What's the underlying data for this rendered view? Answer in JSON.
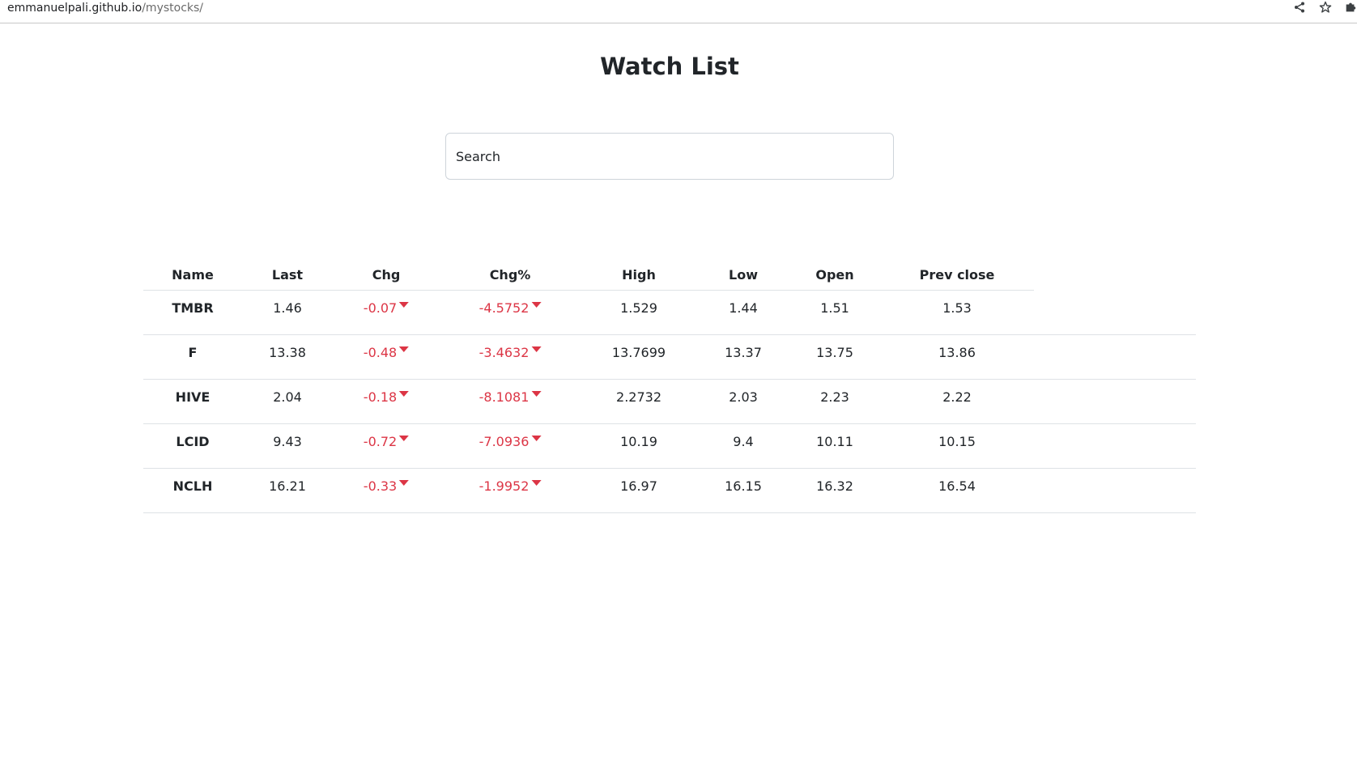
{
  "browser": {
    "url_host": "emmanuelpali.github.io",
    "url_path": "/mystocks/",
    "icons": [
      "share-icon",
      "star-icon",
      "extensions-icon"
    ]
  },
  "page": {
    "title": "Watch List",
    "search_placeholder": "Search"
  },
  "table": {
    "columns": [
      "Name",
      "Last",
      "Chg",
      "Chg%",
      "High",
      "Low",
      "Open",
      "Prev close"
    ],
    "rows": [
      {
        "name": "TMBR",
        "last": "1.46",
        "chg": "-0.07",
        "chg_pct": "-4.5752",
        "high": "1.529",
        "low": "1.44",
        "open": "1.51",
        "prev_close": "1.53"
      },
      {
        "name": "F",
        "last": "13.38",
        "chg": "-0.48",
        "chg_pct": "-3.4632",
        "high": "13.7699",
        "low": "13.37",
        "open": "13.75",
        "prev_close": "13.86"
      },
      {
        "name": "HIVE",
        "last": "2.04",
        "chg": "-0.18",
        "chg_pct": "-8.1081",
        "high": "2.2732",
        "low": "2.03",
        "open": "2.23",
        "prev_close": "2.22"
      },
      {
        "name": "LCID",
        "last": "9.43",
        "chg": "-0.72",
        "chg_pct": "-7.0936",
        "high": "10.19",
        "low": "9.4",
        "open": "10.11",
        "prev_close": "10.15"
      },
      {
        "name": "NCLH",
        "last": "16.21",
        "chg": "-0.33",
        "chg_pct": "-1.9952",
        "high": "16.97",
        "low": "16.15",
        "open": "16.32",
        "prev_close": "16.54"
      }
    ]
  },
  "colors": {
    "negative": "#dc3545",
    "text": "#212529",
    "border": "#dee2e6"
  }
}
